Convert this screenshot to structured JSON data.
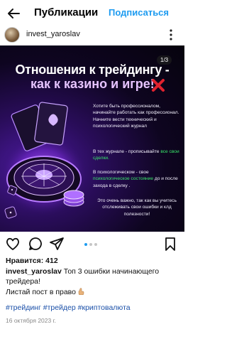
{
  "header": {
    "title": "Публикации",
    "subscribe_label": "Подписаться"
  },
  "author": {
    "username": "invest_yaroslav"
  },
  "post": {
    "counter": "1/3",
    "headline_1": "Отношения к трейдингу -",
    "headline_2": "как к казино и игре!",
    "paragraph_1": "Хотите быть профессионалом, начинайте работать как профессионал. Начните вести технический и психологический журнал",
    "paragraph_2_pre": "В тех журнале - прописывайте",
    "paragraph_2_accent": "все свои сделки.",
    "paragraph_3_pre": "В психологическом - свое",
    "paragraph_3_accent": "психологическое состояние",
    "paragraph_3_post": "до и после захода в сделку .",
    "paragraph_4": "Это очень важно, так как вы учитесь отслеживать свои ошибки и клд полезности!",
    "accent_color": "#39e86a"
  },
  "actions": {
    "icons": [
      "heart-icon",
      "comment-icon",
      "share-icon",
      "bookmark-icon"
    ],
    "carousel_pages": 3,
    "carousel_active": 1
  },
  "likes": {
    "label": "Нравится:",
    "count": "412"
  },
  "caption": {
    "username": "invest_yaroslav",
    "text": "Топ 3 ошибки начинающего трейдера!",
    "line2": "Листай пост в право"
  },
  "hashtags": "#трейдинг #трейдер #криптовалюта",
  "date": "16 октября 2023 г."
}
